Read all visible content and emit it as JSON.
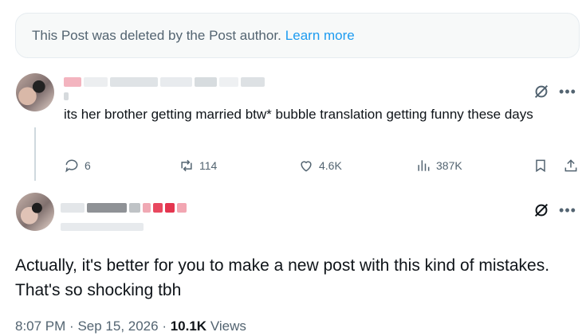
{
  "deleted_notice": {
    "text": "This Post was deleted by the Post author.",
    "link": "Learn more"
  },
  "post": {
    "text": "its her brother getting married btw* bubble translation getting funny these days",
    "actions": {
      "replies": "6",
      "reposts": "114",
      "likes": "4.6K",
      "views": "387K"
    }
  },
  "reply": {
    "text": "Actually, it's better for you to make a new post with this kind of mistakes. That's so shocking tbh",
    "time": "8:07 PM",
    "date": "Sep 15, 2026",
    "views_count": "10.1K",
    "views_label": "Views"
  },
  "colors": {
    "accent": "#1d9bf0",
    "secondary_text": "#536471",
    "primary_text": "#0f1419"
  },
  "icons": {
    "reply": "reply-icon",
    "repost": "repost-icon",
    "like": "heart-icon",
    "views": "views-icon",
    "bookmark": "bookmark-icon",
    "share": "share-icon",
    "grok": "grok-icon",
    "more": "more-icon"
  }
}
